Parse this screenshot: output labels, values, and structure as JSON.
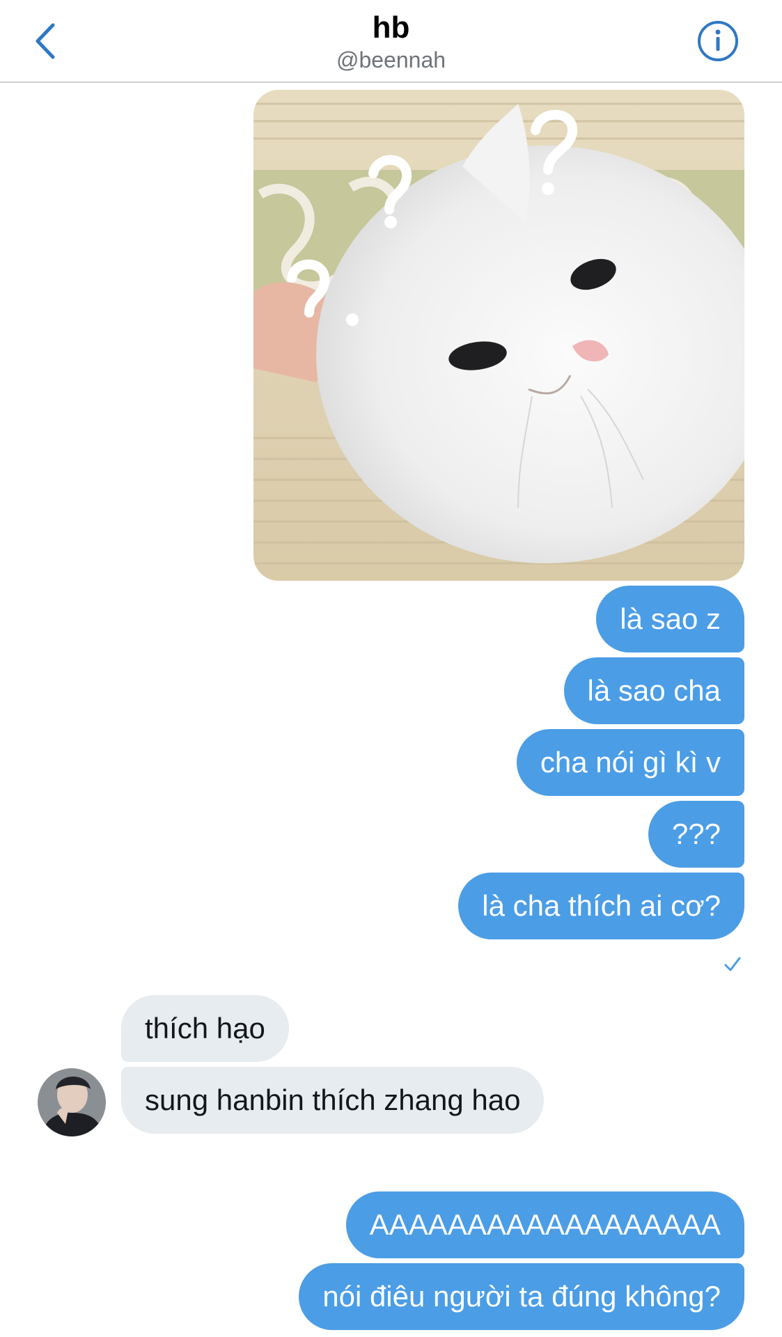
{
  "header": {
    "title": "hb",
    "handle": "@beennah",
    "back_icon": "chevron-left-icon",
    "info_icon": "info-circle-icon",
    "accent_color": "#2f78c4"
  },
  "thread": {
    "outgoing_group_1": [
      "là sao z",
      "là sao cha",
      "cha nói gì kì v",
      "???",
      "là cha thích ai cơ?"
    ],
    "read_receipt_icon": "checkmark-icon",
    "incoming": [
      "thích hạo",
      "sung hanbin thích zhang hao"
    ],
    "outgoing_group_2": [
      "AAAAAAAAAAAAAAAAAA",
      "nói điêu người ta đúng không?"
    ]
  },
  "colors": {
    "outgoing_bubble": "#4b9de6",
    "incoming_bubble": "#e6ecf0"
  }
}
